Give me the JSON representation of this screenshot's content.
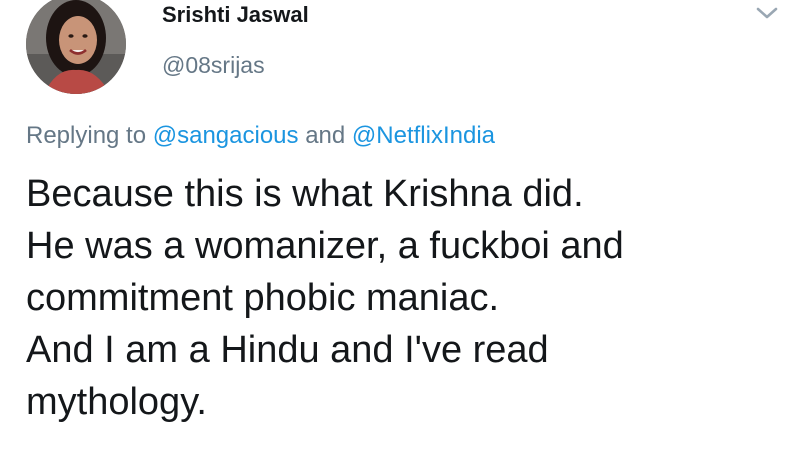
{
  "author": {
    "display_name": "Srishti Jaswal",
    "handle": "@08srija",
    "handle_full": "@08srijas",
    "avatar_icon": "profile-photo"
  },
  "menu_icon": "chevron-down-icon",
  "reply": {
    "prefix": "Replying to",
    "mention_1": "@sangacious",
    "joiner": "and",
    "mention_2": "@NetflixIndia"
  },
  "tweet_lines": [
    "Because this is what Krishna did.",
    "He was a womanizer, a fuckboi and",
    "commitment phobic maniac.",
    "And I am a Hindu and I've read",
    "mythology."
  ],
  "colors": {
    "text": "#14171a",
    "secondary": "#657786",
    "link": "#1b95e0"
  }
}
